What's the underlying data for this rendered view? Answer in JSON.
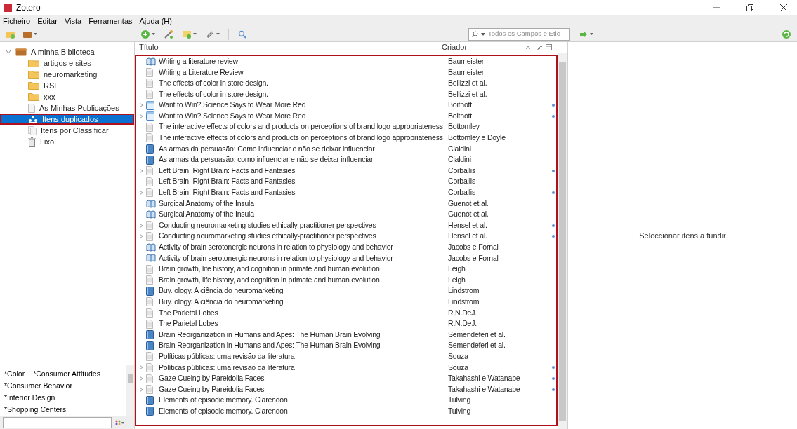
{
  "window": {
    "title": "Zotero"
  },
  "menu": [
    "Ficheiro",
    "Editar",
    "Vista",
    "Ferramentas",
    "Ajuda (H)"
  ],
  "search": {
    "placeholder": "Todos os Campos e Etic"
  },
  "collections": [
    {
      "label": "A minha Biblioteca",
      "kind": "library",
      "selected": false,
      "expanded": true,
      "children": [
        {
          "label": "artigos e sites",
          "kind": "folder",
          "selected": false
        },
        {
          "label": "neuromarketing",
          "kind": "folder",
          "selected": false
        },
        {
          "label": "RSL",
          "kind": "folder",
          "selected": false
        },
        {
          "label": "xxx",
          "kind": "folder",
          "selected": false
        },
        {
          "label": "As Minhas Publicações",
          "kind": "publications",
          "selected": false
        },
        {
          "label": "Itens duplicados",
          "kind": "duplicates",
          "selected": true
        },
        {
          "label": "Itens por Classificar",
          "kind": "unfiled",
          "selected": false
        },
        {
          "label": "Lixo",
          "kind": "trash",
          "selected": false
        }
      ]
    }
  ],
  "tags": [
    "*Color",
    "*Consumer Attitudes",
    "*Consumer Behavior",
    "*Interior Design",
    "*Shopping Centers"
  ],
  "table": {
    "columns": [
      "Título",
      "Criador"
    ],
    "rows": [
      {
        "title": "Writing a literature review",
        "creator": "Baumeister",
        "kind": "book",
        "expandable": false
      },
      {
        "title": "Writing a Literature Review",
        "creator": "Baumeister",
        "kind": "document",
        "expandable": false
      },
      {
        "title": "The effects of color in store design.",
        "creator": "Bellizzi et al.",
        "kind": "document",
        "expandable": false
      },
      {
        "title": "The effects of color in store design.",
        "creator": "Bellizzi et al.",
        "kind": "document",
        "expandable": false
      },
      {
        "title": "Want to Win? Science Says to Wear More Red",
        "creator": "Boitnott",
        "kind": "webpage",
        "expandable": true
      },
      {
        "title": "Want to Win? Science Says to Wear More Red",
        "creator": "Boitnott",
        "kind": "webpage",
        "expandable": true
      },
      {
        "title": "The interactive effects of colors and products on perceptions of brand logo appropriateness",
        "creator": "Bottomley",
        "kind": "document",
        "expandable": false
      },
      {
        "title": "The interactive effects of colors and products on perceptions of brand logo appropriateness",
        "creator": "Bottomley e Doyle",
        "kind": "document",
        "expandable": false
      },
      {
        "title": "As armas da persuasão: Como influenciar e não se deixar influenciar",
        "creator": "Cialdini",
        "kind": "volume",
        "expandable": false
      },
      {
        "title": "As armas da persuasão: como influenciar e não se deixar influenciar",
        "creator": "Cialdini",
        "kind": "volume",
        "expandable": false
      },
      {
        "title": "Left Brain, Right Brain: Facts and Fantasies",
        "creator": "Corballis",
        "kind": "document",
        "expandable": true
      },
      {
        "title": "Left Brain, Right Brain: Facts and Fantasies",
        "creator": "Corballis",
        "kind": "document",
        "expandable": false
      },
      {
        "title": "Left Brain, Right Brain: Facts and Fantasies",
        "creator": "Corballis",
        "kind": "document",
        "expandable": true
      },
      {
        "title": "Surgical Anatomy of the Insula",
        "creator": "Guenot et al.",
        "kind": "book",
        "expandable": false
      },
      {
        "title": "Surgical Anatomy of the Insula",
        "creator": "Guenot et al.",
        "kind": "book",
        "expandable": false
      },
      {
        "title": "Conducting neuromarketing studies ethically-practitioner perspectives",
        "creator": "Hensel et al.",
        "kind": "document",
        "expandable": true
      },
      {
        "title": "Conducting neuromarketing studies ethically-practitioner perspectives",
        "creator": "Hensel et al.",
        "kind": "document",
        "expandable": true
      },
      {
        "title": "Activity of brain serotonergic neurons in relation to physiology and behavior",
        "creator": "Jacobs e Fornal",
        "kind": "book",
        "expandable": false
      },
      {
        "title": "Activity of brain serotonergic neurons in relation to physiology and behavior",
        "creator": "Jacobs e Fornal",
        "kind": "book",
        "expandable": false
      },
      {
        "title": "Brain growth, life history, and cognition in primate and human evolution",
        "creator": "Leigh",
        "kind": "document",
        "expandable": false
      },
      {
        "title": "Brain growth, life history, and cognition in primate and human evolution",
        "creator": "Leigh",
        "kind": "document",
        "expandable": false
      },
      {
        "title": "Buy. ology. A ciência do neuromarketing",
        "creator": "Lindstrom",
        "kind": "volume",
        "expandable": false
      },
      {
        "title": "Buy. ology. A ciência do neuromarketing",
        "creator": "Lindstrom",
        "kind": "document",
        "expandable": false
      },
      {
        "title": "The Parietal Lobes",
        "creator": "R.N.DeJ.",
        "kind": "document",
        "expandable": false
      },
      {
        "title": "The Parietal Lobes",
        "creator": "R.N.DeJ.",
        "kind": "document",
        "expandable": false
      },
      {
        "title": "Brain Reorganization in Humans and Apes: The Human Brain Evolving",
        "creator": "Semendeferi et al.",
        "kind": "volume",
        "expandable": false
      },
      {
        "title": "Brain Reorganization in Humans and Apes: The Human Brain Evolving",
        "creator": "Semendeferi et al.",
        "kind": "volume",
        "expandable": false
      },
      {
        "title": "Políticas públicas: uma revisão da literatura",
        "creator": "Souza",
        "kind": "document",
        "expandable": false
      },
      {
        "title": "Políticas públicas: uma revisão da literatura",
        "creator": "Souza",
        "kind": "document",
        "expandable": true
      },
      {
        "title": "Gaze Cueing by Pareidolia Faces",
        "creator": "Takahashi e Watanabe",
        "kind": "document",
        "expandable": true
      },
      {
        "title": "Gaze Cueing by Pareidolia Faces",
        "creator": "Takahashi e Watanabe",
        "kind": "document",
        "expandable": true
      },
      {
        "title": "Elements of episodic memory. Clarendon",
        "creator": "Tulving",
        "kind": "volume",
        "expandable": false
      },
      {
        "title": "Elements of episodic memory. Clarendon",
        "creator": "Tulving",
        "kind": "volume",
        "expandable": false
      }
    ]
  },
  "item_pane": {
    "message": "Seleccionar itens a fundir"
  }
}
